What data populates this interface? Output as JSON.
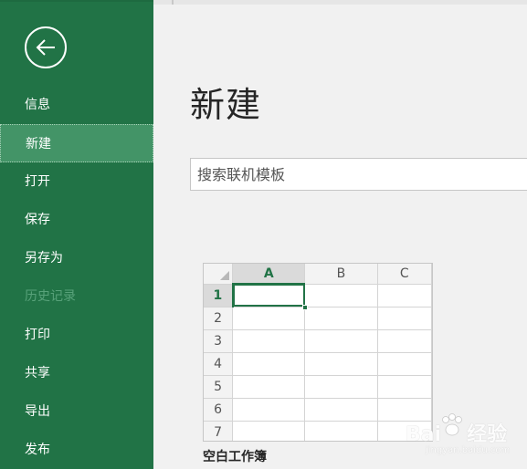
{
  "sidebar": {
    "items": [
      {
        "label": "信息",
        "state": "normal"
      },
      {
        "label": "新建",
        "state": "active"
      },
      {
        "label": "打开",
        "state": "normal"
      },
      {
        "label": "保存",
        "state": "normal"
      },
      {
        "label": "另存为",
        "state": "normal"
      },
      {
        "label": "历史记录",
        "state": "disabled"
      },
      {
        "label": "打印",
        "state": "normal"
      },
      {
        "label": "共享",
        "state": "normal"
      },
      {
        "label": "导出",
        "state": "normal"
      },
      {
        "label": "发布",
        "state": "normal"
      }
    ]
  },
  "main": {
    "title": "新建",
    "search": {
      "placeholder": "搜索联机模板",
      "value": ""
    },
    "template": {
      "label": "空白工作簿",
      "columns": [
        "A",
        "B",
        "C"
      ],
      "rows": [
        "1",
        "2",
        "3",
        "4",
        "5",
        "6",
        "7"
      ],
      "selected_cell": "A1"
    }
  },
  "watermark": {
    "text": "Bai",
    "brand": "经验",
    "sub": "jingyan.baidu.com"
  },
  "colors": {
    "sidebar_bg": "#217346",
    "sidebar_active": "#439467",
    "accent": "#217346",
    "main_bg": "#f1f1f1"
  }
}
